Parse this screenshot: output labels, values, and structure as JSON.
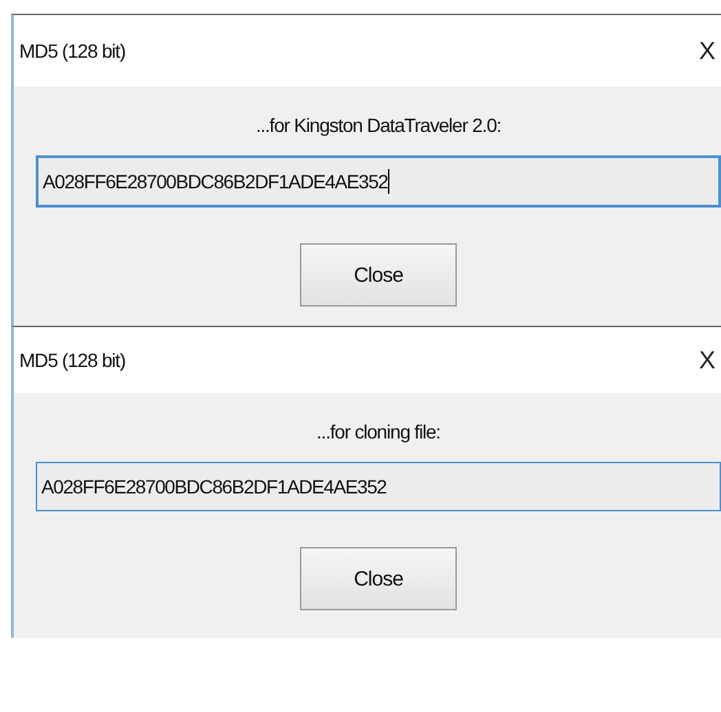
{
  "dialogs": [
    {
      "title": "MD5 (128 bit)",
      "close_glyph": "X",
      "label": "...for Kingston DataTraveler 2.0:",
      "value": "A028FF6E28700BDC86B2DF1ADE4AE352",
      "focused": true,
      "button": "Close"
    },
    {
      "title": "MD5 (128 bit)",
      "close_glyph": "X",
      "label": "...for cloning file:",
      "value": "A028FF6E28700BDC86B2DF1ADE4AE352",
      "focused": false,
      "button": "Close"
    }
  ]
}
